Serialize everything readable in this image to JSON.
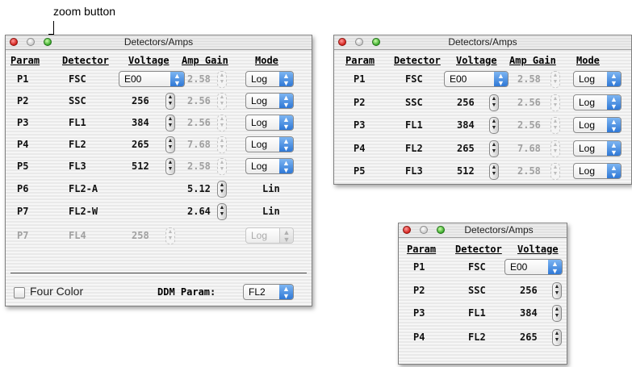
{
  "callout": {
    "label": "zoom button"
  },
  "window_title": "Detectors/Amps",
  "headers": {
    "param": "Param",
    "detector": "Detector",
    "voltage": "Voltage",
    "amp_gain": "Amp Gain",
    "mode": "Mode"
  },
  "window_a": {
    "rows": [
      {
        "param": "P1",
        "detector": "FSC",
        "voltage": "E00",
        "amp_gain": "2.58",
        "mode": "Log"
      },
      {
        "param": "P2",
        "detector": "SSC",
        "voltage": "256",
        "amp_gain": "2.56",
        "mode": "Log"
      },
      {
        "param": "P3",
        "detector": "FL1",
        "voltage": "384",
        "amp_gain": "2.56",
        "mode": "Log"
      },
      {
        "param": "P4",
        "detector": "FL2",
        "voltage": "265",
        "amp_gain": "7.68",
        "mode": "Log"
      },
      {
        "param": "P5",
        "detector": "FL3",
        "voltage": "512",
        "amp_gain": "2.58",
        "mode": "Log"
      },
      {
        "param": "P6",
        "detector": "FL2-A",
        "voltage": "",
        "amp_gain": "5.12",
        "mode": "Lin"
      },
      {
        "param": "P7",
        "detector": "FL2-W",
        "voltage": "",
        "amp_gain": "2.64",
        "mode": "Lin"
      },
      {
        "param": "P7",
        "detector": "FL4",
        "voltage": "258",
        "amp_gain": "",
        "mode": "Log"
      }
    ],
    "four_color_label": "Four Color",
    "ddm_label": "DDM Param:",
    "ddm_value": "FL2"
  },
  "window_b": {
    "rows": [
      {
        "param": "P1",
        "detector": "FSC",
        "voltage": "E00",
        "amp_gain": "2.58",
        "mode": "Log"
      },
      {
        "param": "P2",
        "detector": "SSC",
        "voltage": "256",
        "amp_gain": "2.56",
        "mode": "Log"
      },
      {
        "param": "P3",
        "detector": "FL1",
        "voltage": "384",
        "amp_gain": "2.56",
        "mode": "Log"
      },
      {
        "param": "P4",
        "detector": "FL2",
        "voltage": "265",
        "amp_gain": "7.68",
        "mode": "Log"
      },
      {
        "param": "P5",
        "detector": "FL3",
        "voltage": "512",
        "amp_gain": "2.58",
        "mode": "Log"
      }
    ]
  },
  "window_c": {
    "rows": [
      {
        "param": "P1",
        "detector": "FSC",
        "voltage": "E00"
      },
      {
        "param": "P2",
        "detector": "SSC",
        "voltage": "256"
      },
      {
        "param": "P3",
        "detector": "FL1",
        "voltage": "384"
      },
      {
        "param": "P4",
        "detector": "FL2",
        "voltage": "265"
      }
    ]
  },
  "colors": {
    "close": "#d3201a",
    "zoom": "#3aa92a",
    "popup_arrow": "#2f78d6",
    "disabled_text": "#a0a0a0"
  },
  "icons": [
    "close-icon",
    "minimize-icon",
    "zoom-icon",
    "popup-arrows-icon",
    "stepper-arrows-icon"
  ]
}
